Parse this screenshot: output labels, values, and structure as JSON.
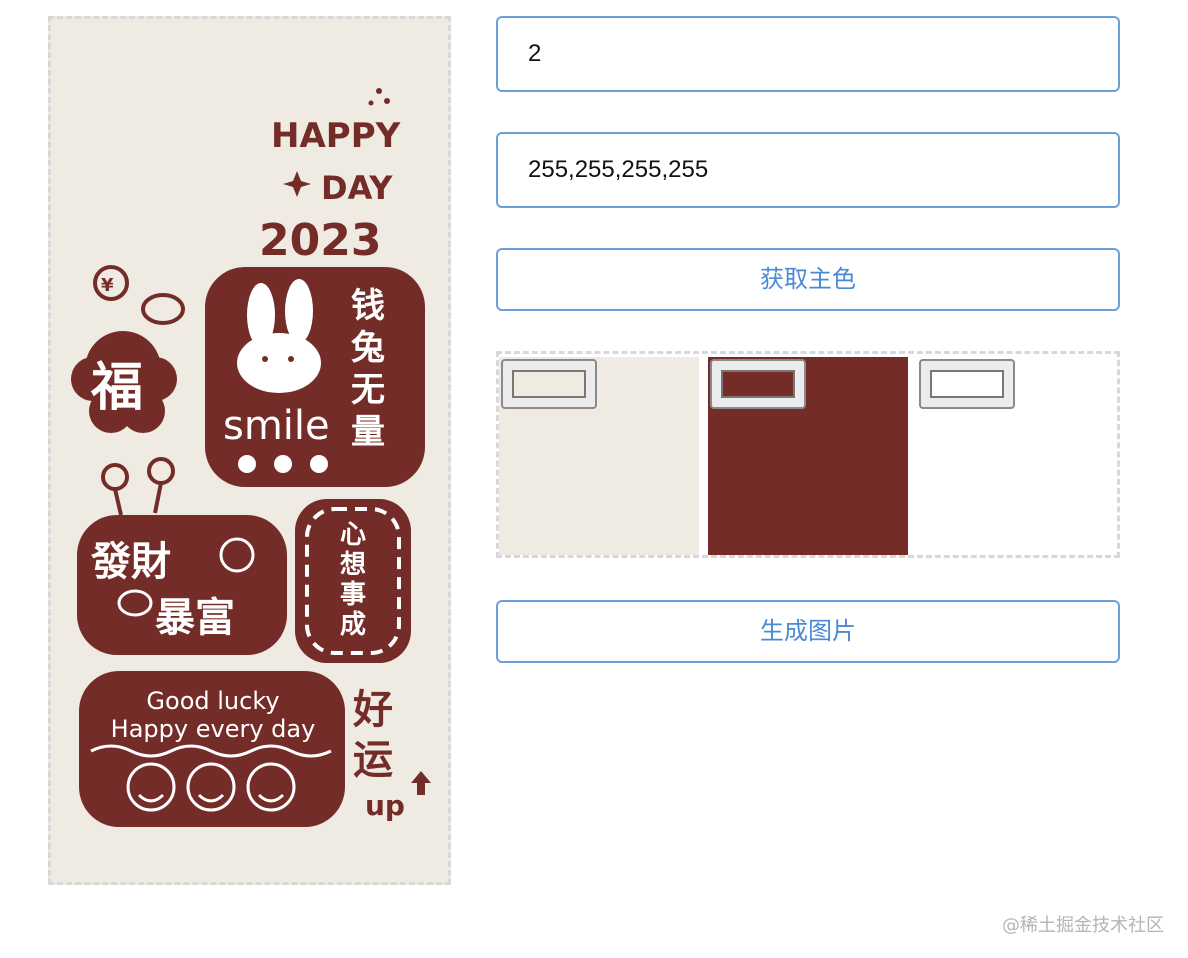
{
  "inputs": {
    "count": {
      "value": "2"
    },
    "color": {
      "value": "255,255,255,255"
    }
  },
  "buttons": {
    "get_main_color": "获取主色",
    "generate_image": "生成图片"
  },
  "swatches": [
    {
      "color": "#efebe2"
    },
    {
      "color": "#742c28"
    },
    {
      "color": "#ffffff"
    }
  ],
  "poster": {
    "text": {
      "happy": "HAPPY",
      "day": "DAY",
      "year": "2023",
      "fu": "福",
      "money_col": [
        "钱",
        "兔",
        "无",
        "量"
      ],
      "smile": "smile",
      "facai": "發財",
      "baofu": "暴富",
      "xinxiang": [
        "心",
        "想",
        "事",
        "成"
      ],
      "good_lucky": "Good lucky",
      "happy_every_day": "Happy every day",
      "haoyun": [
        "好",
        "运"
      ],
      "up": "up"
    }
  },
  "watermark": "@稀土掘金技术社区"
}
